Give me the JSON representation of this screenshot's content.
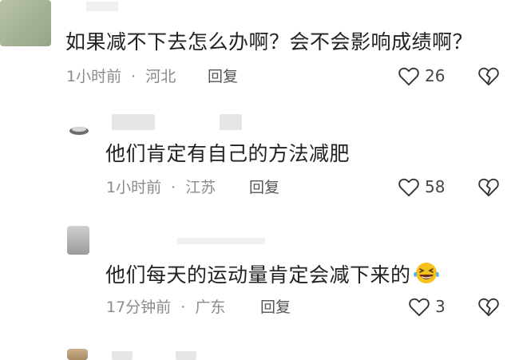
{
  "comments": [
    {
      "text": "如果减不下去怎么办啊？会不会影响成绩啊？",
      "time": "1小时前",
      "separator": "·",
      "location": "河北",
      "reply_label": "回复",
      "likes": "26"
    },
    {
      "text": "他们肯定有自己的方法减肥",
      "time": "1小时前",
      "separator": "·",
      "location": "江苏",
      "reply_label": "回复",
      "likes": "58"
    },
    {
      "text": "他们每天的运动量肯定会减下来的",
      "emoji": "laughing-tears-emoji",
      "time": "17分钟前",
      "separator": "·",
      "location": "广东",
      "reply_label": "回复",
      "likes": "3"
    }
  ],
  "icons": {
    "like": "heart-outline-icon",
    "dislike": "broken-heart-icon"
  },
  "colors": {
    "text": "#222222",
    "meta": "#8a8a8a",
    "icon": "#333333",
    "avatar_green": "#a9b596"
  }
}
